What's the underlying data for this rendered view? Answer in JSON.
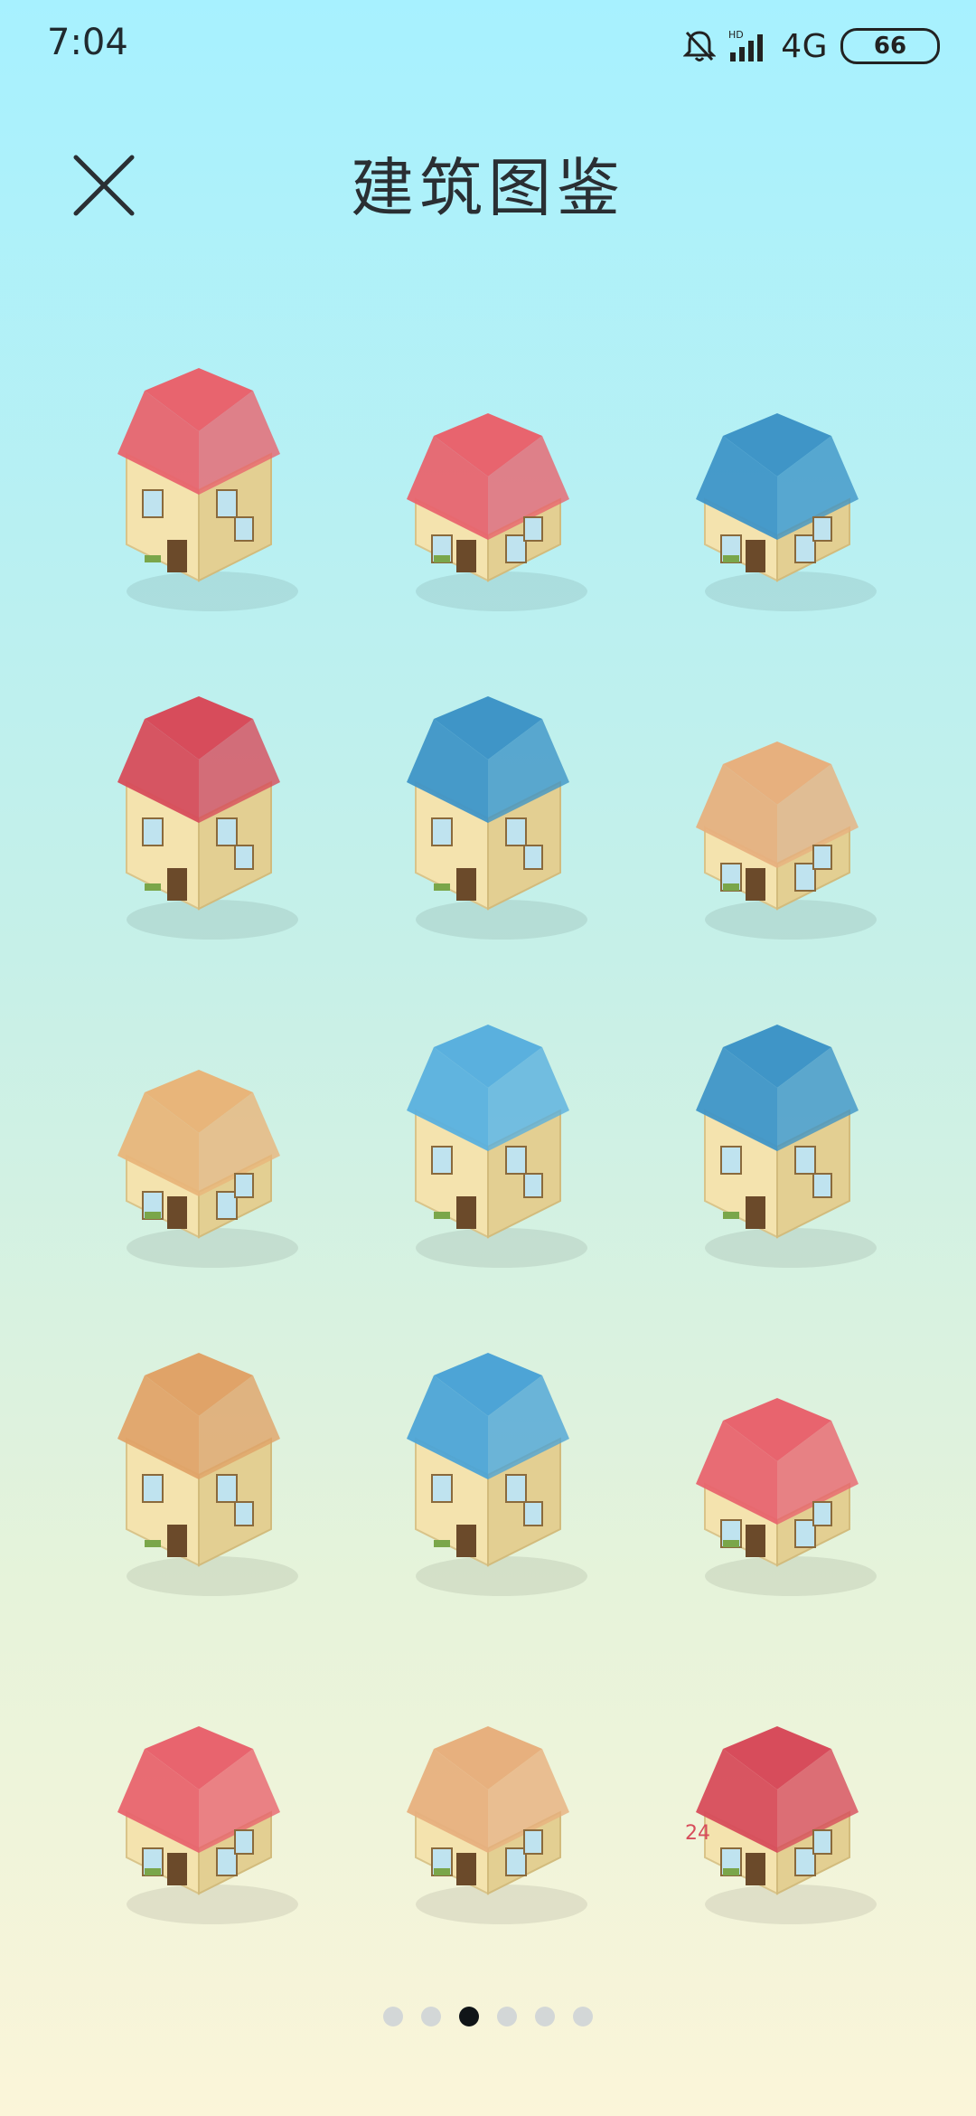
{
  "status_bar": {
    "time": "7:04",
    "network": "4G",
    "hd_label": "HD",
    "battery": "66",
    "icons": [
      "bell-muted-icon",
      "signal-bars-icon",
      "battery-icon"
    ]
  },
  "header": {
    "title": "建筑图鉴",
    "close_icon": "close-icon"
  },
  "buildings": [
    {
      "name": "heart-house",
      "roof": "#E8646E",
      "wall": "#F4E3AE"
    },
    {
      "name": "chimney-cottage",
      "roof": "#E8646E",
      "wall": "#F4E3AE"
    },
    {
      "name": "satellite-blue-house",
      "roof": "#3F95C7",
      "wall": "#F4E3AE"
    },
    {
      "name": "clock-tower-house",
      "roof": "#D74C5B",
      "wall": "#F4E3AE"
    },
    {
      "name": "blue-balcony-apartment",
      "roof": "#3F95C7",
      "wall": "#F4E3AE"
    },
    {
      "name": "pergola-house",
      "roof": "#E7B07E",
      "wall": "#F4E3AE"
    },
    {
      "name": "telescope-house",
      "roof": "#E8B57A",
      "wall": "#F4E3AE"
    },
    {
      "name": "blue-gable-villa",
      "roof": "#5AB0DE",
      "wall": "#F4E3AE"
    },
    {
      "name": "stair-garage-house",
      "roof": "#3F95C7",
      "wall": "#F4E3AE"
    },
    {
      "name": "modern-box-house",
      "roof": "#E0A368",
      "wall": "#F4E3AE"
    },
    {
      "name": "round-blue-tower",
      "roof": "#4DA4D6",
      "wall": "#F4E3AE"
    },
    {
      "name": "flag-pavilion",
      "roof": "#E8646E",
      "wall": "#F4E3AE"
    },
    {
      "name": "open-cutaway-house",
      "roof": "#E8646E",
      "wall": "#F4E3AE"
    },
    {
      "name": "cafe-house",
      "roof": "#E7B07E",
      "wall": "#F4E3AE"
    },
    {
      "name": "24h-store",
      "roof": "#D74C5B",
      "wall": "#F4E3AE",
      "sign": "24"
    }
  ],
  "pagination": {
    "total": 6,
    "current": 3
  }
}
